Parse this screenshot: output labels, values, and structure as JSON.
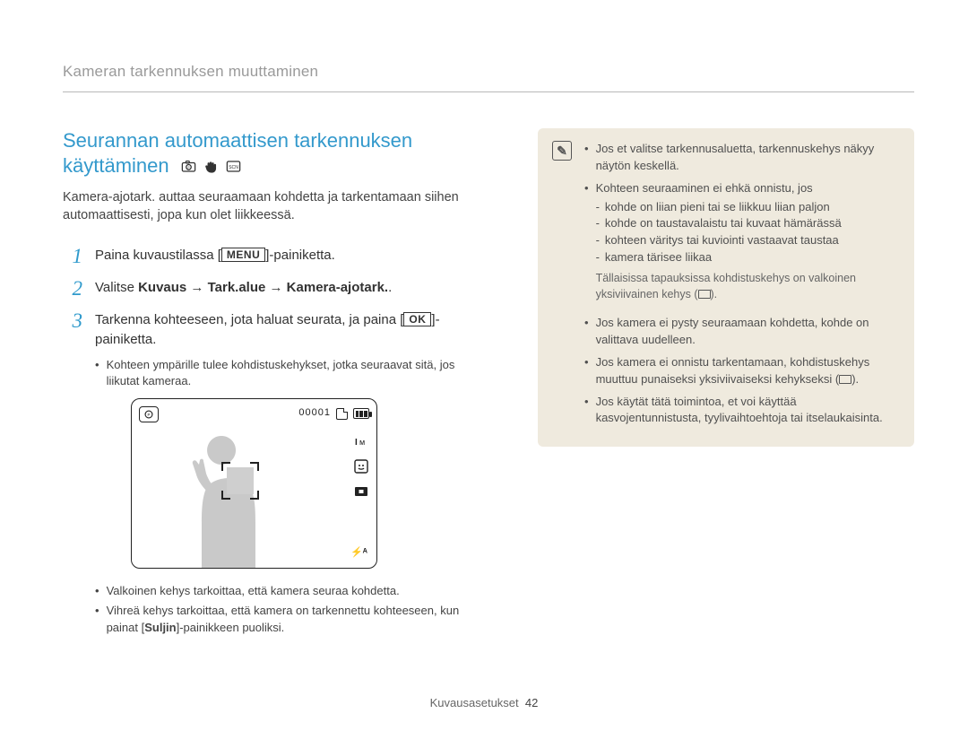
{
  "header": {
    "title": "Kameran tarkennuksen muuttaminen"
  },
  "section": {
    "title": "Seurannan automaattisen tarkennuksen käyttäminen",
    "intro": "Kamera-ajotark. auttaa seuraamaan kohdetta ja tarkentamaan siihen automaattisesti, jopa kun olet liikkeessä."
  },
  "steps": {
    "s1_a": "Paina kuvaustilassa [",
    "s1_menu": "MENU",
    "s1_b": "]-painiketta.",
    "s2_a": "Valitse ",
    "s2_bold": "Kuvaus → Tark.alue → Kamera-ajotark.",
    "s2_b": ".",
    "s3_a": "Tarkenna kohteeseen, jota haluat seurata, ja paina [",
    "s3_ok": "OK",
    "s3_b": "]-painiketta."
  },
  "sub_bullets_after3": {
    "b1": "Kohteen ympärille tulee kohdistuskehykset, jotka seuraavat sitä, jos liikutat kameraa."
  },
  "camera_display": {
    "counter": "00001"
  },
  "after_display": {
    "b1": "Valkoinen kehys tarkoittaa, että kamera seuraa kohdetta.",
    "b2_a": "Vihreä kehys tarkoittaa, että kamera on tarkennettu kohteeseen, kun painat [",
    "b2_bold": "Suljin",
    "b2_b": "]-painikkeen puoliksi."
  },
  "info": {
    "b1": "Jos et valitse tarkennusaluetta, tarkennuskehys näkyy näytön keskellä.",
    "b2_lead": "Kohteen seuraaminen ei ehkä onnistu, jos",
    "b2_d1": "kohde on liian pieni tai se liikkuu liian paljon",
    "b2_d2": "kohde on taustavalaistu tai kuvaat hämärässä",
    "b2_d3": "kohteen väritys tai kuviointi vastaavat taustaa",
    "b2_d4": "kamera tärisee liikaa",
    "note": "Tällaisissa tapauksissa kohdistuskehys on valkoinen yksiviivainen kehys (",
    "note_end": ").",
    "b3": "Jos kamera ei pysty seuraamaan kohdetta, kohde on valittava uudelleen.",
    "b4_a": "Jos kamera ei onnistu tarkentamaan, kohdistuskehys muuttuu punaiseksi yksiviivaiseksi kehykseksi (",
    "b4_b": ").",
    "b5": "Jos käytät tätä toimintoa, et voi käyttää kasvojentunnistusta, tyylivaihtoehtoja tai itselaukaisinta."
  },
  "footer": {
    "section": "Kuvausasetukset",
    "page": "42"
  }
}
